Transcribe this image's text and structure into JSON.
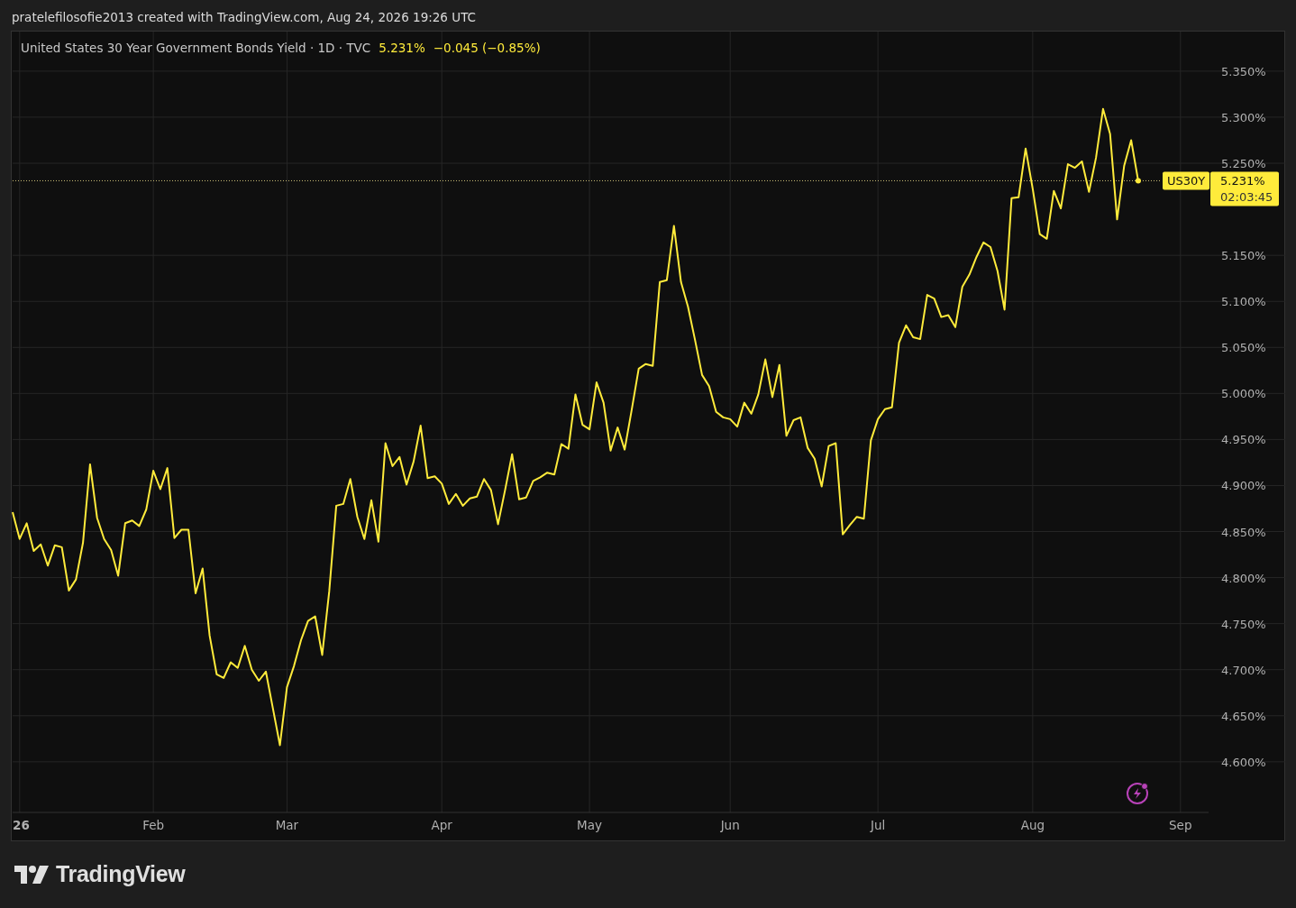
{
  "caption": "pratelefilosofie2013 created with TradingView.com, Aug 24, 2026 19:26 UTC",
  "legend": {
    "symbol": "United States 30 Year Government Bonds Yield · 1D · TVC",
    "price": "5.231%",
    "change": "−0.045 (−0.85%)"
  },
  "price_label": {
    "price": "5.231%",
    "countdown": "02:03:45"
  },
  "chart_data": {
    "type": "line",
    "grid": true,
    "ylim": [
      4.545,
      5.393
    ],
    "categories": [
      null,
      "26",
      null,
      null,
      null,
      null,
      null,
      null,
      null,
      null,
      null,
      null,
      null,
      null,
      null,
      null,
      null,
      null,
      null,
      null,
      "Feb",
      null,
      null,
      null,
      null,
      null,
      null,
      null,
      null,
      null,
      null,
      null,
      null,
      null,
      null,
      null,
      null,
      null,
      null,
      "Mar",
      null,
      null,
      null,
      null,
      null,
      null,
      null,
      null,
      null,
      null,
      null,
      null,
      null,
      null,
      null,
      null,
      null,
      null,
      null,
      null,
      null,
      "Apr",
      null,
      null,
      null,
      null,
      null,
      null,
      null,
      null,
      null,
      null,
      null,
      null,
      null,
      null,
      null,
      null,
      null,
      null,
      null,
      null,
      "May",
      null,
      null,
      null,
      null,
      null,
      null,
      null,
      null,
      null,
      null,
      null,
      null,
      null,
      null,
      null,
      null,
      null,
      null,
      null,
      "Jun",
      null,
      null,
      null,
      null,
      null,
      null,
      null,
      null,
      null,
      null,
      null,
      null,
      null,
      null,
      null,
      null,
      null,
      null,
      null,
      null,
      "Jul",
      null,
      null,
      null,
      null,
      null,
      null,
      null,
      null,
      null,
      null,
      null,
      null,
      null,
      null,
      null,
      null,
      null,
      null,
      null,
      null,
      null,
      "Aug",
      null,
      null,
      null,
      null,
      null,
      null,
      null,
      null,
      null,
      null,
      null,
      null,
      null,
      null,
      null,
      null,
      null,
      null,
      null,
      null,
      "Sep",
      null,
      null,
      null,
      null
    ],
    "yticks": [
      {
        "value": 4.6,
        "label": "4.600%"
      },
      {
        "value": 4.65,
        "label": "4.650%"
      },
      {
        "value": 4.7,
        "label": "4.700%"
      },
      {
        "value": 4.75,
        "label": "4.750%"
      },
      {
        "value": 4.8,
        "label": "4.800%"
      },
      {
        "value": 4.85,
        "label": "4.850%"
      },
      {
        "value": 4.9,
        "label": "4.900%"
      },
      {
        "value": 4.95,
        "label": "4.950%"
      },
      {
        "value": 5.0,
        "label": "5.000%"
      },
      {
        "value": 5.05,
        "label": "5.050%"
      },
      {
        "value": 5.1,
        "label": "5.100%"
      },
      {
        "value": 5.15,
        "label": "5.150%"
      },
      {
        "value": 5.25,
        "label": "5.250%"
      },
      {
        "value": 5.3,
        "label": "5.300%"
      },
      {
        "value": 5.35,
        "label": "5.350%"
      }
    ],
    "series": [
      {
        "name": "US30Y",
        "color": "#ffeb3b",
        "values": [
          4.871,
          4.842,
          4.859,
          4.829,
          4.836,
          4.813,
          4.835,
          4.833,
          4.786,
          4.798,
          4.838,
          4.923,
          4.865,
          4.842,
          4.83,
          4.802,
          4.859,
          4.862,
          4.856,
          4.874,
          4.916,
          4.896,
          4.919,
          4.843,
          4.852,
          4.852,
          4.783,
          4.81,
          4.737,
          4.695,
          4.691,
          4.708,
          4.702,
          4.726,
          4.7,
          4.688,
          4.698,
          4.658,
          4.618,
          4.681,
          4.704,
          4.732,
          4.753,
          4.758,
          4.716,
          4.785,
          4.878,
          4.88,
          4.907,
          4.866,
          4.842,
          4.884,
          4.839,
          4.946,
          4.921,
          4.931,
          4.901,
          4.926,
          4.965,
          4.908,
          4.91,
          4.902,
          4.88,
          4.891,
          4.878,
          4.886,
          4.888,
          4.907,
          4.895,
          4.858,
          4.895,
          4.934,
          4.885,
          4.887,
          4.905,
          4.909,
          4.914,
          4.912,
          4.945,
          4.94,
          4.999,
          4.966,
          4.961,
          5.012,
          4.99,
          4.938,
          4.963,
          4.939,
          4.982,
          5.027,
          5.032,
          5.03,
          5.121,
          5.123,
          5.182,
          5.121,
          5.094,
          5.058,
          5.02,
          5.008,
          4.98,
          4.974,
          4.972,
          4.964,
          4.99,
          4.978,
          4.999,
          5.037,
          4.996,
          5.031,
          4.954,
          4.971,
          4.974,
          4.941,
          4.929,
          4.899,
          4.943,
          4.946,
          4.847,
          4.857,
          4.866,
          4.864,
          4.949,
          4.972,
          4.983,
          4.985,
          5.055,
          5.074,
          5.061,
          5.059,
          5.107,
          5.103,
          5.083,
          5.085,
          5.072,
          5.116,
          5.129,
          5.148,
          5.164,
          5.159,
          5.133,
          5.091,
          5.212,
          5.213,
          5.266,
          5.222,
          5.173,
          5.168,
          5.22,
          5.201,
          5.249,
          5.245,
          5.252,
          5.219,
          5.256,
          5.309,
          5.282,
          5.189,
          5.247,
          5.275,
          5.231,
          null,
          null,
          null,
          null,
          null,
          null,
          null,
          null,
          null,
          null
        ]
      }
    ]
  },
  "brand": "TradingView"
}
